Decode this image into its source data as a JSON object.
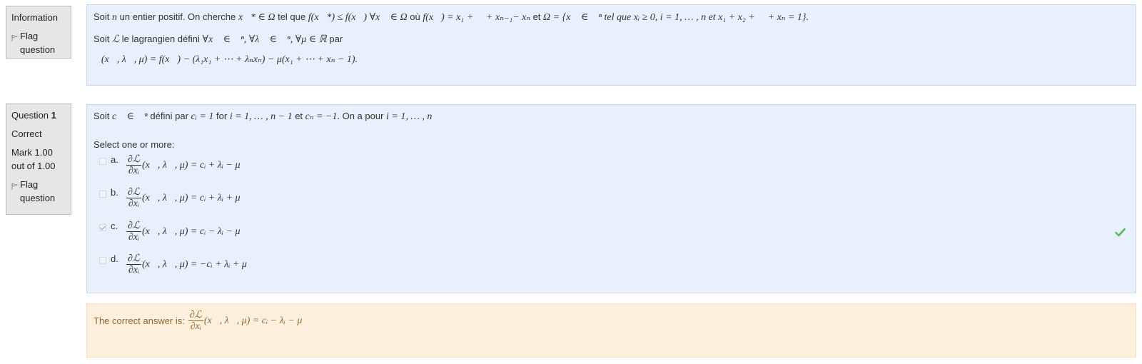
{
  "info_panel": {
    "title": "Information",
    "flag_label": "Flag question"
  },
  "info_content": {
    "line1_prefix": "Soit",
    "line1_n": "n",
    "line1_mid": "un entier positif. On cherche",
    "line1_math1": "x⃗* ∈ Ω",
    "line1_tel": "tel que",
    "line1_math2": "f(x⃗*) ≤ f(x⃗) ∀x⃗ ∈ Ω",
    "line1_ou": "où",
    "line1_math3": "f(x⃗) = x₁ + ⋯ + xₙ₋₁− xₙ",
    "line1_et": "et",
    "line1_math4": "Ω = {x⃗ ∈ ℝⁿ  tel que xᵢ ≥ 0,  i = 1, … , n et x₁ + x₂ + ⋯ + xₙ = 1}.",
    "line2_prefix": "Soit",
    "line2_L": "ℒ",
    "line2_mid": "le lagrangien défini",
    "line2_math": "∀x⃗ ∈ ℝⁿ,  ∀λ⃗ ∈ ℝⁿ,  ∀μ ∈ ℝ",
    "line2_suffix": "par",
    "line3_math": "ℒ(x⃗, λ⃗, μ) = f(x⃗) − (λ₁x₁ + ⋯ + λₙxₙ) − μ(x₁ + ⋯ + xₙ − 1)."
  },
  "question": {
    "label": "Question",
    "number": "1",
    "state": "Correct",
    "mark": "Mark 1.00 out of 1.00",
    "flag_label": "Flag question",
    "text_prefix": "Soit",
    "text_math1": "c⃗ ∈ ℝⁿ",
    "text_mid": "défini par",
    "text_math2": "cᵢ = 1",
    "text_for": "for",
    "text_math3": "i = 1, … , n − 1",
    "text_et": "et",
    "text_math4": "cₙ = −1.",
    "text_on": "On a pour",
    "text_math5": "i = 1, … , n",
    "prompt": "Select one or more:",
    "frac_num": "∂ℒ",
    "frac_den": "∂xᵢ",
    "answers": [
      {
        "letter": "a.",
        "rhs": "(x⃗, λ⃗, μ) = cᵢ + λᵢ − μ",
        "checked": false
      },
      {
        "letter": "b.",
        "rhs": "(x⃗, λ⃗, μ) = cᵢ + λᵢ + μ",
        "checked": false
      },
      {
        "letter": "c.",
        "rhs": "(x⃗, λ⃗, μ) = cᵢ − λᵢ − μ",
        "checked": true
      },
      {
        "letter": "d.",
        "rhs": "(x⃗, λ⃗, μ) = −cᵢ + λᵢ + μ",
        "checked": false
      }
    ]
  },
  "feedback": {
    "prefix": "The correct answer is:",
    "rhs": "(x⃗, λ⃗, μ) = cᵢ − λᵢ − μ"
  },
  "colors": {
    "content_bg": "#e8f0fb",
    "feedback_bg": "#fcefdc",
    "feedback_text": "#8e662e",
    "correct_tick": "#5cb85c"
  }
}
